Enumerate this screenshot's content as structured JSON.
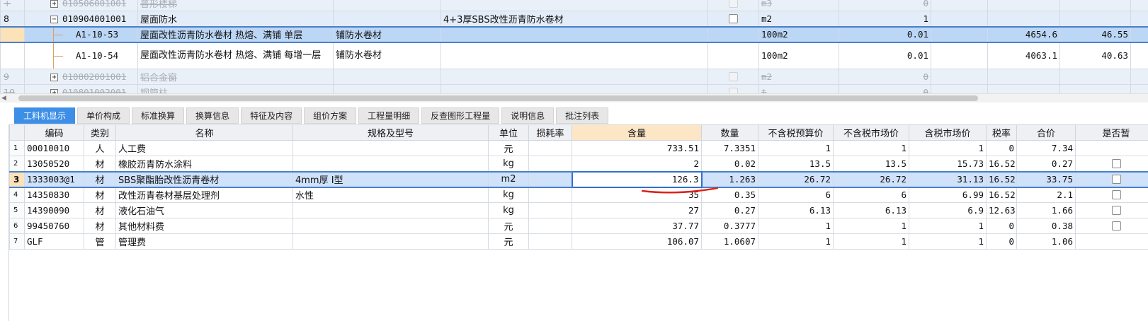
{
  "top_rows": [
    {
      "row": "+",
      "code": "010506001001",
      "name": "普形楼梯",
      "spec": "",
      "unit": "m3",
      "qty": "0",
      "style": "gray",
      "partial": true
    },
    {
      "row": "8",
      "code": "010904001001",
      "name": "屋面防水",
      "desc": "",
      "feature": "4+3厚SBS改性沥青防水卷材",
      "unit": "m2",
      "qty": "1",
      "style": "blue"
    },
    {
      "row": "",
      "code": "A1-10-53",
      "name": "屋面改性沥青防水卷材 热熔、满铺 单层",
      "desc": "铺防水卷材",
      "unit": "100m2",
      "qty": "0.01",
      "price": "4654.6",
      "total": "46.55",
      "style": "sel"
    },
    {
      "row": "",
      "code": "A1-10-54",
      "name": "屋面改性沥青防水卷材 热熔、满铺 每增一层",
      "desc": "铺防水卷材",
      "unit": "100m2",
      "qty": "0.01",
      "price": "4063.1",
      "total": "40.63",
      "style": "tall"
    },
    {
      "row": "9",
      "code": "010802001001",
      "name": "铝合金窗",
      "unit": "m2",
      "qty": "0",
      "style": "gray"
    },
    {
      "row": "10",
      "code": "010801002001",
      "name": "钢管柱",
      "unit": "t",
      "qty": "0",
      "style": "gray"
    }
  ],
  "tabs": [
    "工料机显示",
    "单价构成",
    "标准换算",
    "换算信息",
    "特征及内容",
    "组价方案",
    "工程量明细",
    "反查图形工程量",
    "说明信息",
    "批注列表"
  ],
  "columns": [
    "编码",
    "类别",
    "名称",
    "规格及型号",
    "单位",
    "损耗率",
    "含量",
    "数量",
    "不含税预算价",
    "不含税市场价",
    "含税市场价",
    "税率",
    "合价",
    "是否暂"
  ],
  "rows": [
    {
      "idx": "1",
      "code": "00010010",
      "type": "人",
      "name": "人工费",
      "spec": "",
      "unit": "元",
      "loss": "",
      "content": "733.51",
      "qty": "7.3351",
      "pre_budget": "1",
      "pre_market": "1",
      "tax_market": "1",
      "tax_rate": "0",
      "total": "7.34",
      "check": false
    },
    {
      "idx": "2",
      "code": "13050520",
      "type": "材",
      "name": "橡胶沥青防水涂料",
      "spec": "",
      "unit": "kg",
      "loss": "",
      "content": "2",
      "qty": "0.02",
      "pre_budget": "13.5",
      "pre_market": "13.5",
      "tax_market": "15.73",
      "tax_rate": "16.52",
      "total": "0.27",
      "check": true
    },
    {
      "idx": "3",
      "code": "1333003@1",
      "type": "材",
      "name": "SBS聚酯胎改性沥青卷材",
      "spec": "4mm厚 I型",
      "unit": "m2",
      "loss": "",
      "content": "126.3",
      "qty": "1.263",
      "pre_budget": "26.72",
      "pre_market": "26.72",
      "tax_market": "31.13",
      "tax_rate": "16.52",
      "total": "33.75",
      "check": true
    },
    {
      "idx": "4",
      "code": "14350830",
      "type": "材",
      "name": "改性沥青卷材基层处理剂",
      "spec": "水性",
      "unit": "kg",
      "loss": "",
      "content": "35",
      "qty": "0.35",
      "pre_budget": "6",
      "pre_market": "6",
      "tax_market": "6.99",
      "tax_rate": "16.52",
      "total": "2.1",
      "check": true
    },
    {
      "idx": "5",
      "code": "14390090",
      "type": "材",
      "name": "液化石油气",
      "spec": "",
      "unit": "kg",
      "loss": "",
      "content": "27",
      "qty": "0.27",
      "pre_budget": "6.13",
      "pre_market": "6.13",
      "tax_market": "6.9",
      "tax_rate": "12.63",
      "total": "1.66",
      "check": true
    },
    {
      "idx": "6",
      "code": "99450760",
      "type": "材",
      "name": "其他材料费",
      "spec": "",
      "unit": "元",
      "loss": "",
      "content": "37.77",
      "qty": "0.3777",
      "pre_budget": "1",
      "pre_market": "1",
      "tax_market": "1",
      "tax_rate": "0",
      "total": "0.38",
      "check": true
    },
    {
      "idx": "7",
      "code": "GLF",
      "type": "管",
      "name": "管理费",
      "spec": "",
      "unit": "元",
      "loss": "",
      "content": "106.07",
      "qty": "1.0607",
      "pre_budget": "1",
      "pre_market": "1",
      "tax_market": "1",
      "tax_rate": "0",
      "total": "1.06",
      "check": false
    }
  ],
  "colors": {
    "accent": "#3d8ee7",
    "selection": "#cfe2fa",
    "header_highlight": "#fde6c6",
    "annotation": "#e0201a"
  },
  "icons": {
    "expand": "plus-box-icon",
    "checkbox": "checkbox-icon",
    "scroll_left": "triangle-left-icon"
  }
}
